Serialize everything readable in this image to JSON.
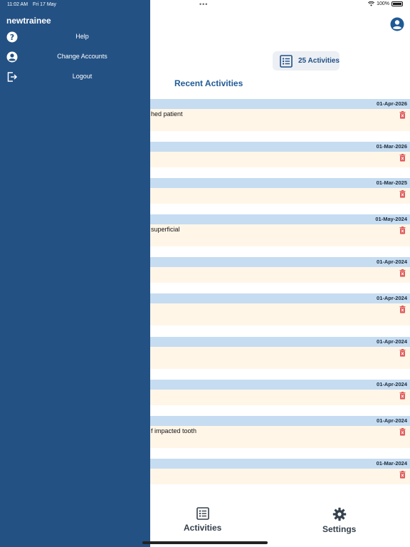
{
  "status_bar": {
    "time": "11:02 AM",
    "date": "Fri 17 May",
    "battery": "100%"
  },
  "drawer": {
    "username": "newtrainee",
    "items": [
      {
        "label": "Help",
        "icon": "help-circle-icon"
      },
      {
        "label": "Change Accounts",
        "icon": "account-circle-icon"
      },
      {
        "label": "Logout",
        "icon": "logout-icon"
      }
    ]
  },
  "header": {
    "activities_count": "25 Activities",
    "recent_title": "Recent Activities"
  },
  "activities": [
    {
      "date": "01-Apr-2026",
      "description": "hed patient"
    },
    {
      "date": "01-Mar-2026",
      "description": ""
    },
    {
      "date": "01-Mar-2025",
      "description": ""
    },
    {
      "date": "01-May-2024",
      "description": "superficial"
    },
    {
      "date": "01-Apr-2024",
      "description": ""
    },
    {
      "date": "01-Apr-2024",
      "description": ""
    },
    {
      "date": "01-Apr-2024",
      "description": ""
    },
    {
      "date": "01-Apr-2024",
      "description": ""
    },
    {
      "date": "01-Apr-2024",
      "description": "f impacted tooth"
    },
    {
      "date": "01-Mar-2024",
      "description": ""
    }
  ],
  "tabs": [
    {
      "label": "Activities",
      "icon": "list-icon"
    },
    {
      "label": "Settings",
      "icon": "gear-icon"
    }
  ],
  "colors": {
    "drawer": "#235184",
    "date_bar": "#c6dcf1",
    "row_body": "#fff6e8",
    "trash": "#e05a5a",
    "accent": "#1f5a96"
  }
}
